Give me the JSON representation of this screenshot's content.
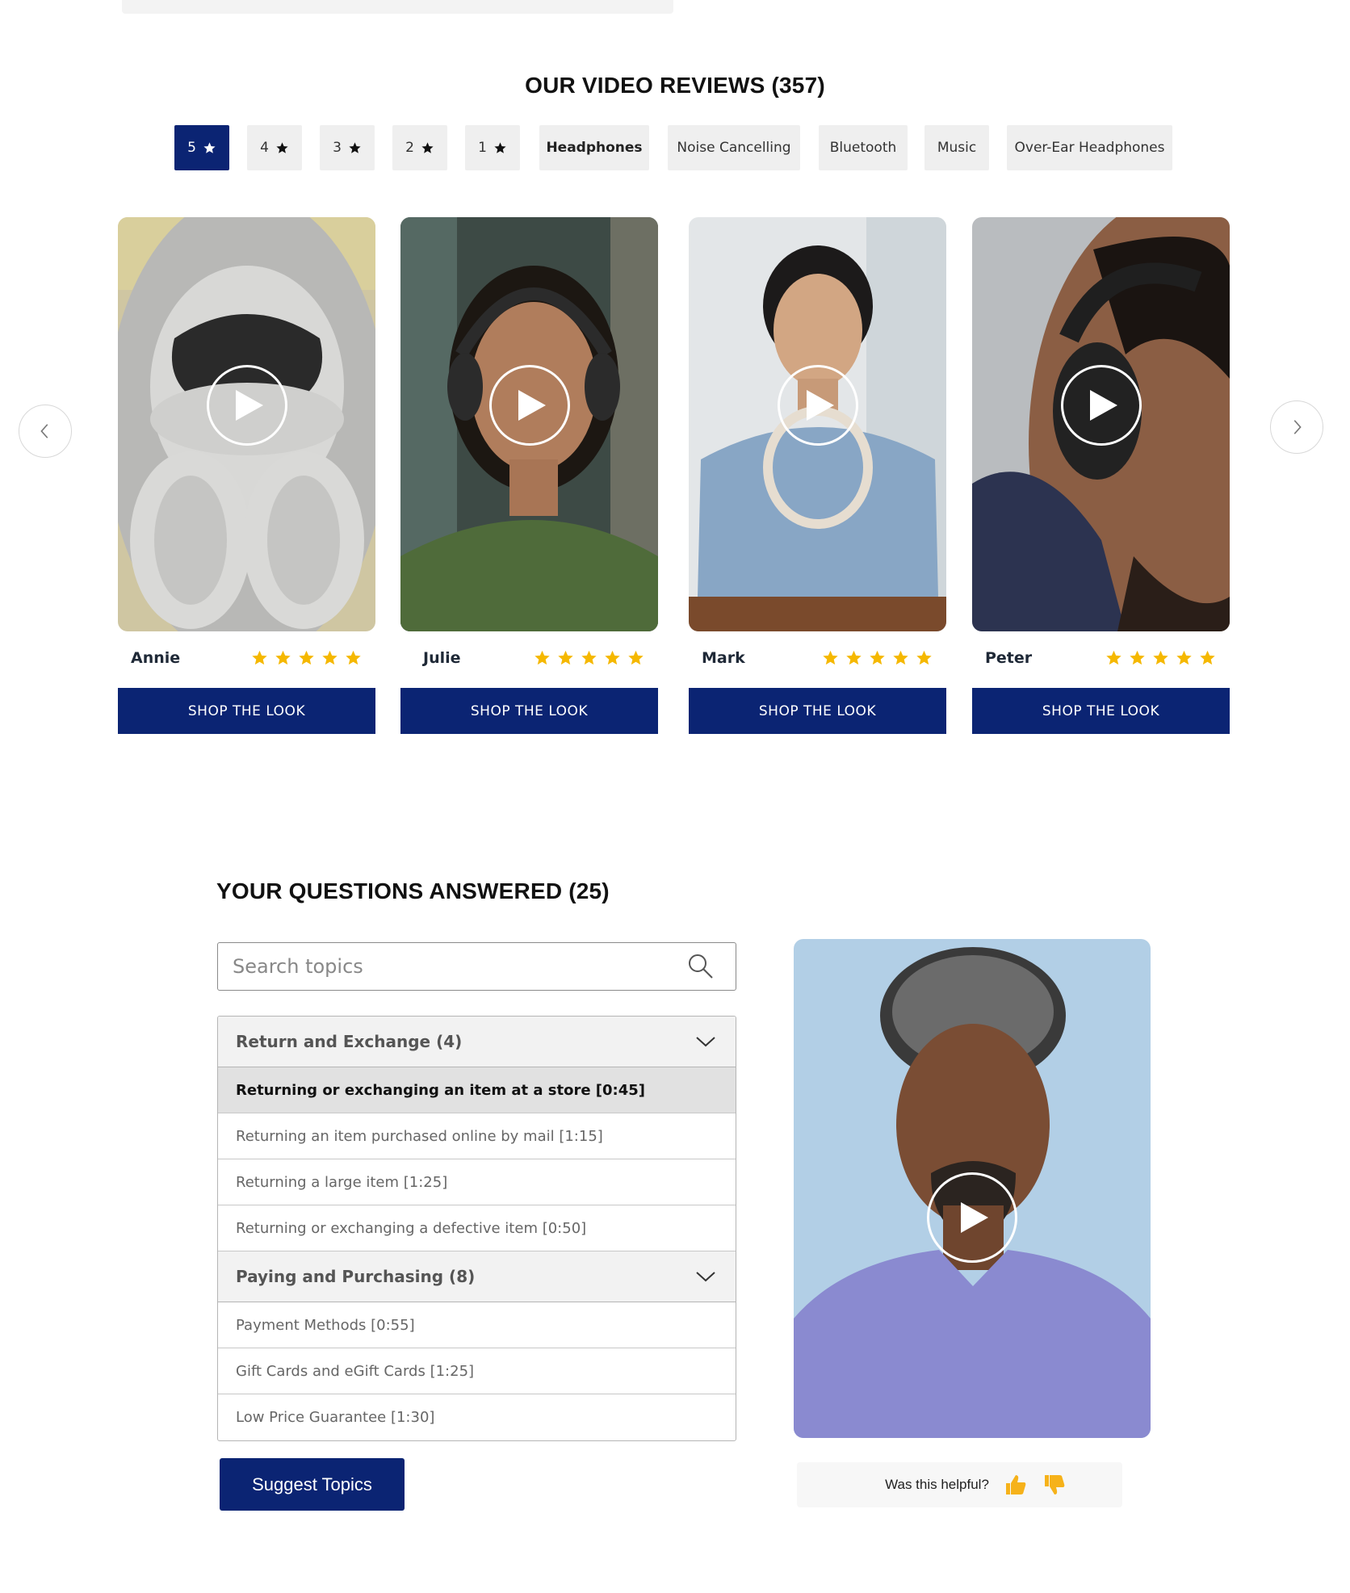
{
  "reviews": {
    "title": "OUR VIDEO REVIEWS (357)",
    "filters": [
      {
        "label": "5",
        "star": true,
        "active": true
      },
      {
        "label": "4",
        "star": true
      },
      {
        "label": "3",
        "star": true
      },
      {
        "label": "2",
        "star": true
      },
      {
        "label": "1",
        "star": true
      },
      {
        "label": "Headphones"
      },
      {
        "label": "Noise Cancelling"
      },
      {
        "label": "Bluetooth"
      },
      {
        "label": "Music"
      },
      {
        "label": "Over-Ear Headphones"
      }
    ],
    "cards": [
      {
        "name": "Annie",
        "rating": 5,
        "button": "SHOP THE LOOK"
      },
      {
        "name": "Julie",
        "rating": 5,
        "button": "SHOP THE LOOK"
      },
      {
        "name": "Mark",
        "rating": 5,
        "button": "SHOP THE LOOK"
      },
      {
        "name": "Peter",
        "rating": 5,
        "button": "SHOP THE LOOK"
      }
    ]
  },
  "qa": {
    "title": "YOUR QUESTIONS ANSWERED (25)",
    "search_placeholder": "Search topics",
    "groups": [
      {
        "header": "Return and Exchange (4)",
        "items": [
          "Returning or exchanging an item at a store [0:45]",
          "Returning an item purchased online by mail [1:15]",
          "Returning a large item [1:25]",
          "Returning or exchanging a defective item [0:50]"
        ]
      },
      {
        "header": "Paying and Purchasing (8)",
        "items": [
          "Payment Methods [0:55]",
          "Gift Cards and eGift Cards [1:25]",
          "Low Price Guarantee [1:30]"
        ]
      }
    ],
    "suggest_label": "Suggest Topics",
    "helpful_label": "Was this helpful?"
  },
  "colors": {
    "brand": "#0b2473",
    "star": "#f5b800",
    "chip_bg": "#efefef"
  },
  "icons": [
    "star-icon",
    "play-icon",
    "chevron-left-icon",
    "chevron-right-icon",
    "search-icon",
    "chevron-down-icon",
    "thumbs-up-icon",
    "thumbs-down-icon"
  ]
}
